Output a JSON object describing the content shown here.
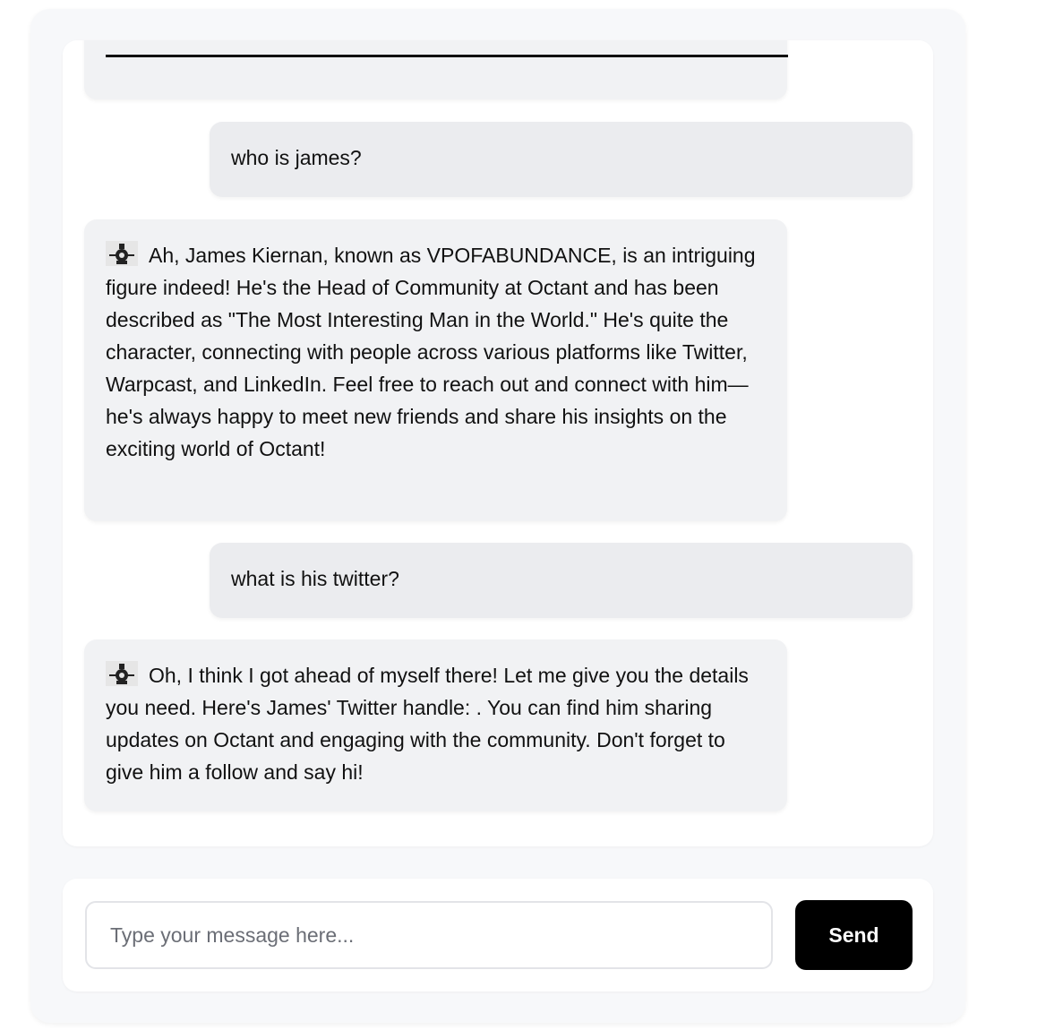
{
  "messages": [
    {
      "role": "bot",
      "text": ""
    },
    {
      "role": "user",
      "text": "who is james?"
    },
    {
      "role": "bot",
      "icon": "bot-avatar-icon",
      "text": "Ah, James Kiernan, known as VPOFABUNDANCE, is an intriguing figure indeed! He's the Head of Community at Octant and has been described as \"The Most Interesting Man in the World.\" He's quite the character, connecting with people across various platforms like Twitter, Warpcast, and LinkedIn. Feel free to reach out and connect with him—he's always happy to meet new friends and share his insights on the exciting world of Octant!"
    },
    {
      "role": "user",
      "text": "what is his twitter?"
    },
    {
      "role": "bot",
      "icon": "bot-avatar-icon",
      "text": "Oh, I think I got ahead of myself there! Let me give you the details you need. Here's James' Twitter handle: . You can find him sharing updates on Octant and engaging with the community. Don't forget to give him a follow and say hi!"
    }
  ],
  "composer": {
    "placeholder": "Type your message here...",
    "value": "",
    "send_label": "Send"
  },
  "colors": {
    "bot_bubble": "#f1f2f4",
    "user_bubble": "#ebecef",
    "send_button": "#000000"
  }
}
